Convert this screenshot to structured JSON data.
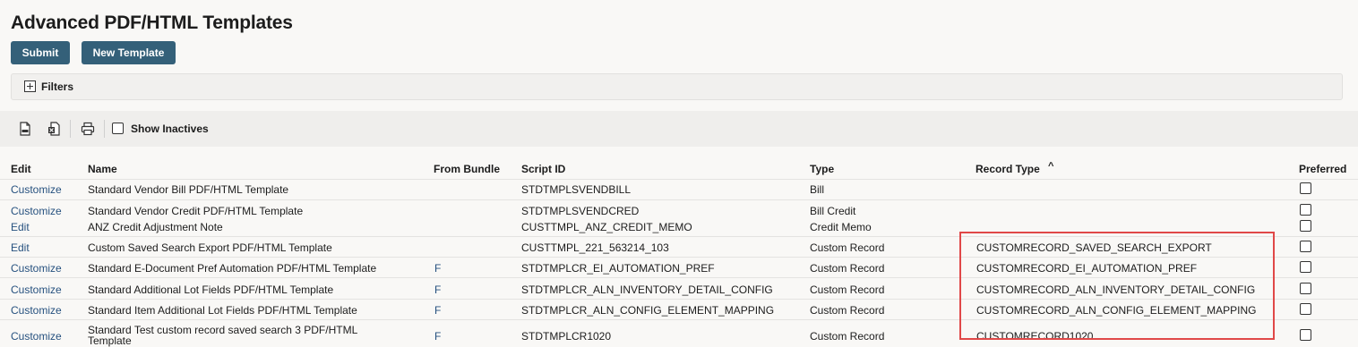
{
  "page": {
    "title": "Advanced PDF/HTML Templates"
  },
  "buttons": {
    "submit": "Submit",
    "new_template": "New Template"
  },
  "filters": {
    "label": "Filters"
  },
  "toolbar": {
    "show_inactives_label": "Show Inactives",
    "icons": [
      "export-csv-icon",
      "export-excel-icon",
      "print-icon"
    ]
  },
  "table": {
    "headers": {
      "edit": "Edit",
      "name": "Name",
      "from_bundle": "From Bundle",
      "script_id": "Script ID",
      "type": "Type",
      "record_type": "Record Type",
      "preferred": "Preferred"
    },
    "sort_indicator": "^",
    "rows": [
      {
        "edit": "Customize",
        "name": "Standard Vendor Bill PDF/HTML Template",
        "from_bundle": "",
        "script_id": "STDTMPLSVENDBILL",
        "type": "Bill",
        "record_type": ""
      },
      {
        "edit": "Customize",
        "name": "Standard Vendor Credit PDF/HTML Template",
        "from_bundle": "",
        "script_id": "STDTMPLSVENDCRED",
        "type": "Bill Credit",
        "record_type": ""
      },
      {
        "edit": "Edit",
        "name": "ANZ Credit Adjustment Note",
        "from_bundle": "",
        "script_id": "CUSTTMPL_ANZ_CREDIT_MEMO",
        "type": "Credit Memo",
        "record_type": ""
      },
      {
        "edit": "Edit",
        "name": "Custom Saved Search Export PDF/HTML Template",
        "from_bundle": "",
        "script_id": "CUSTTMPL_221_563214_103",
        "type": "Custom Record",
        "record_type": "CUSTOMRECORD_SAVED_SEARCH_EXPORT"
      },
      {
        "edit": "Customize",
        "name": "Standard E-Document Pref Automation PDF/HTML Template",
        "from_bundle": "F",
        "script_id": "STDTMPLCR_EI_AUTOMATION_PREF",
        "type": "Custom Record",
        "record_type": "CUSTOMRECORD_EI_AUTOMATION_PREF"
      },
      {
        "edit": "Customize",
        "name": "Standard Additional Lot Fields PDF/HTML Template",
        "from_bundle": "F",
        "script_id": "STDTMPLCR_ALN_INVENTORY_DETAIL_CONFIG",
        "type": "Custom Record",
        "record_type": "CUSTOMRECORD_ALN_INVENTORY_DETAIL_CONFIG"
      },
      {
        "edit": "Customize",
        "name": "Standard Item Additional Lot Fields PDF/HTML Template",
        "from_bundle": "F",
        "script_id": "STDTMPLCR_ALN_CONFIG_ELEMENT_MAPPING",
        "type": "Custom Record",
        "record_type": "CUSTOMRECORD_ALN_CONFIG_ELEMENT_MAPPING"
      },
      {
        "edit": "Customize",
        "name": "Standard Test custom record saved search 3 PDF/HTML Template",
        "from_bundle": "F",
        "script_id": "STDTMPLCR1020",
        "type": "Custom Record",
        "record_type": "CUSTOMRECORD1020"
      }
    ]
  },
  "colors": {
    "button": "#346079",
    "link": "#26517f",
    "highlight": "#e04848"
  }
}
